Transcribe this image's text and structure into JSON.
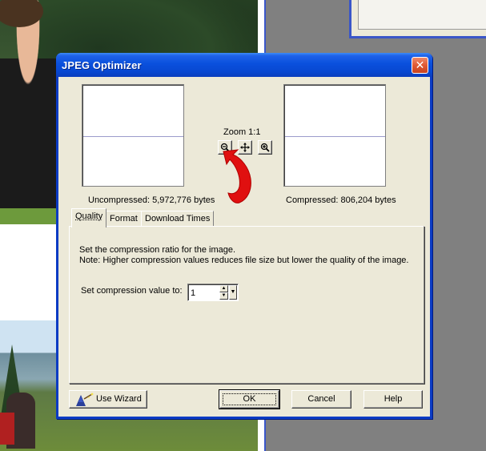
{
  "dialog": {
    "title": "JPEG Optimizer",
    "close_glyph": "✕"
  },
  "preview": {
    "uncompressed_label": "Uncompressed:  5,972,776 bytes",
    "compressed_label": "Compressed: 806,204 bytes",
    "zoom_label": "Zoom 1:1",
    "zoom_buttons": [
      {
        "icon": "zoom-out-icon",
        "glyph": "🔍"
      },
      {
        "icon": "pan-icon",
        "glyph": "✥"
      },
      {
        "icon": "zoom-in-icon",
        "glyph": "🔍"
      }
    ]
  },
  "tabs": [
    {
      "label": "Quality",
      "active": true
    },
    {
      "label": "Format",
      "active": false
    },
    {
      "label": "Download Times",
      "active": false
    }
  ],
  "quality_panel": {
    "description_line1": "Set the compression ratio for the image.",
    "description_line2": "Note:  Higher compression values reduces file size but lower the quality of the image.",
    "compression_label": "Set compression value to:",
    "compression_value": "1"
  },
  "buttons": {
    "wizard": "Use Wizard",
    "ok": "OK",
    "cancel": "Cancel",
    "help": "Help"
  },
  "colors": {
    "title_bar": "#0a50dd",
    "close_button": "#e05a35",
    "dialog_face": "#ece9d8",
    "annotation_arrow": "#e01010"
  }
}
